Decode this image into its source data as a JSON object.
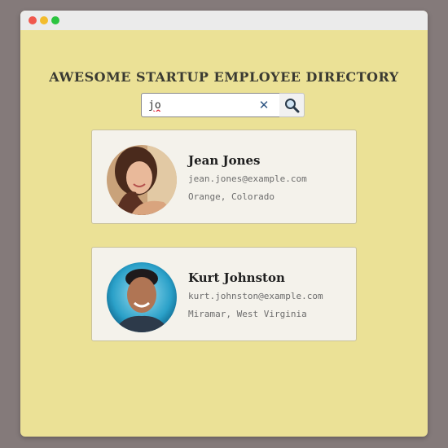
{
  "window": {
    "controls": [
      "close",
      "minimize",
      "maximize"
    ]
  },
  "page": {
    "title": "AWESOME STARTUP EMPLOYEE DIRECTORY"
  },
  "search": {
    "value": "jo",
    "placeholder": "",
    "clear_icon": "close-icon",
    "submit_icon": "magnifier-icon"
  },
  "employees": [
    {
      "name": "Jean Jones",
      "email": "jean.jones@example.com",
      "location": "Orange, Colorado"
    },
    {
      "name": "Kurt Johnston",
      "email": "kurt.johnston@example.com",
      "location": "Miramar, West Virginia"
    }
  ],
  "colors": {
    "background": "#847a7a",
    "app_background": "#ebe196",
    "card_background": "#f4f2eb",
    "clear_icon": "#2f5683"
  }
}
